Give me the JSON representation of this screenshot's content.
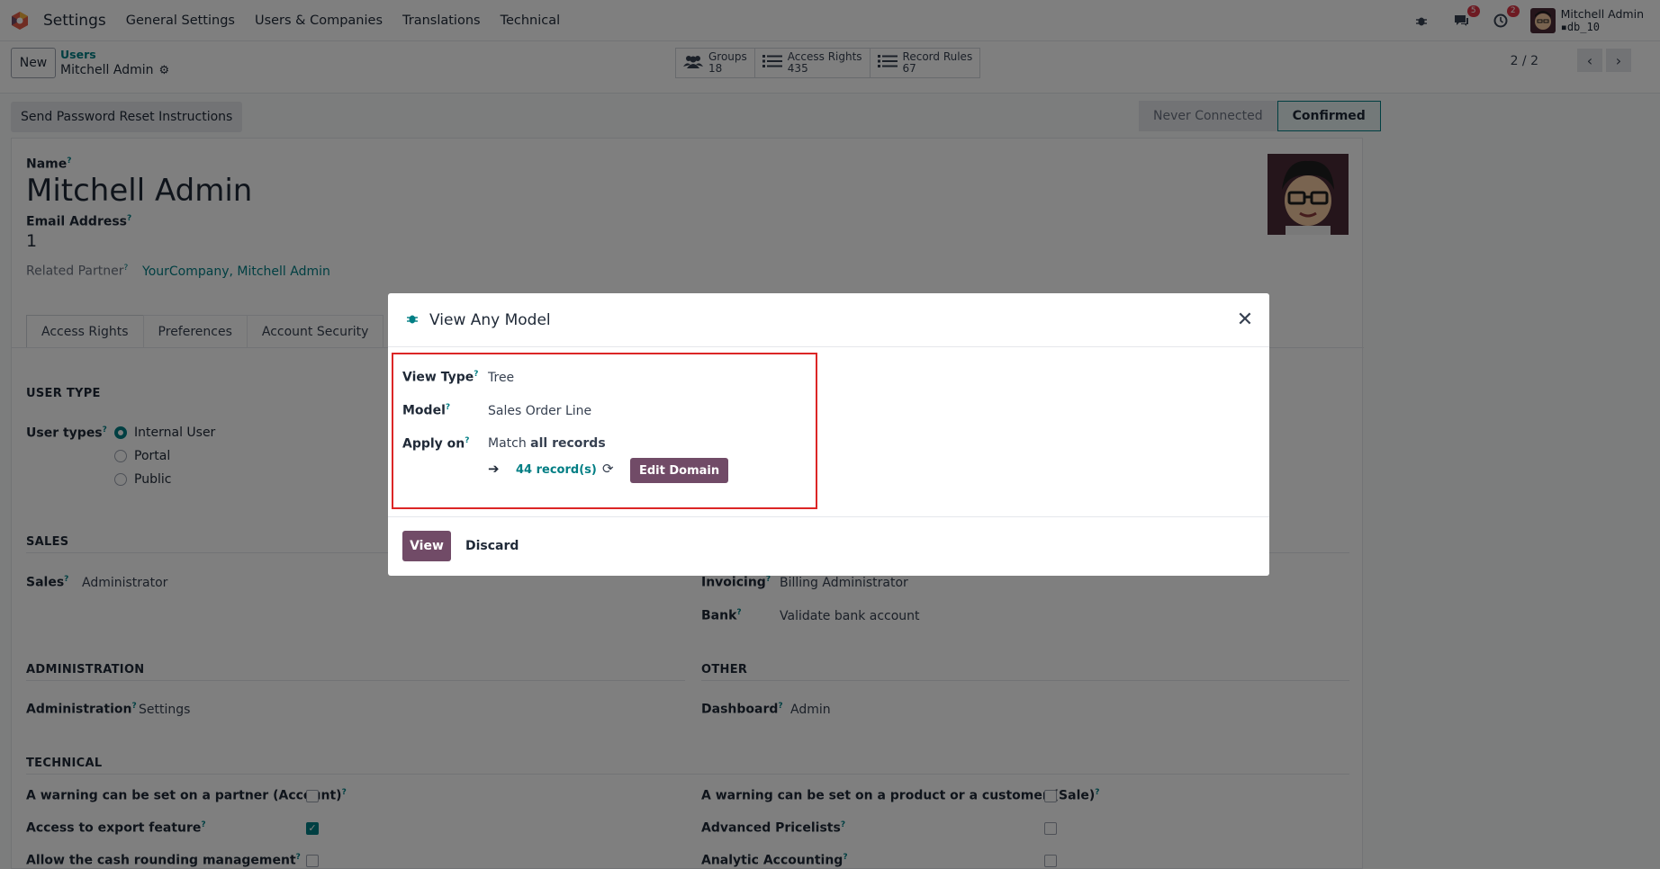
{
  "navbar": {
    "app_name": "Settings",
    "menus": [
      "General Settings",
      "Users & Companies",
      "Translations",
      "Technical"
    ],
    "messages_badge": "5",
    "activity_badge": "2",
    "user_name": "Mitchell Admin",
    "db_name": "db_10"
  },
  "control": {
    "new_label": "New",
    "breadcrumb_parent": "Users",
    "breadcrumb_current": "Mitchell Admin",
    "smart_buttons": [
      {
        "label": "Groups",
        "count": "18"
      },
      {
        "label": "Access Rights",
        "count": "435"
      },
      {
        "label": "Record Rules",
        "count": "67"
      }
    ],
    "pager": "2 / 2"
  },
  "actions": {
    "reset_label": "Send Password Reset Instructions",
    "status_never": "Never Connected",
    "status_confirmed": "Confirmed"
  },
  "form": {
    "name_label": "Name",
    "name_value": "Mitchell Admin",
    "email_label": "Email Address",
    "email_value": "1",
    "partner_label": "Related Partner",
    "partner_value": "YourCompany, Mitchell Admin",
    "tabs": [
      "Access Rights",
      "Preferences",
      "Account Security"
    ],
    "user_type_section": "USER TYPE",
    "user_types_label": "User types",
    "user_types": [
      "Internal User",
      "Portal",
      "Public"
    ],
    "sales_section": "SALES",
    "sales_label": "Sales",
    "sales_value": "Administrator",
    "invoicing_label": "Invoicing",
    "invoicing_value": "Billing Administrator",
    "bank_label": "Bank",
    "bank_value": "Validate bank account",
    "admin_section": "ADMINISTRATION",
    "admin_label": "Administration",
    "admin_value": "Settings",
    "other_section": "OTHER",
    "dashboard_label": "Dashboard",
    "dashboard_value": "Admin",
    "technical_section": "TECHNICAL",
    "tech_left": [
      {
        "label": "A warning can be set on a partner (Account)",
        "checked": false
      },
      {
        "label": "Access to export feature",
        "checked": true
      },
      {
        "label": "Allow the cash rounding management",
        "checked": false
      }
    ],
    "tech_right": [
      {
        "label": "A warning can be set on a product or a customer (Sale)",
        "checked": false
      },
      {
        "label": "Advanced Pricelists",
        "checked": false
      },
      {
        "label": "Analytic Accounting",
        "checked": false
      }
    ]
  },
  "modal": {
    "title": "View Any Model",
    "view_type_label": "View Type",
    "view_type_value": "Tree",
    "model_label": "Model",
    "model_value": "Sales Order Line",
    "apply_on_label": "Apply on",
    "apply_match": "Match",
    "apply_all": "all records",
    "records_link": "44 record(s)",
    "edit_domain": "Edit Domain",
    "view_button": "View",
    "discard_button": "Discard"
  },
  "colors": {
    "accent": "#714b67",
    "teal": "#017e84",
    "highlight": "#dc2626"
  }
}
